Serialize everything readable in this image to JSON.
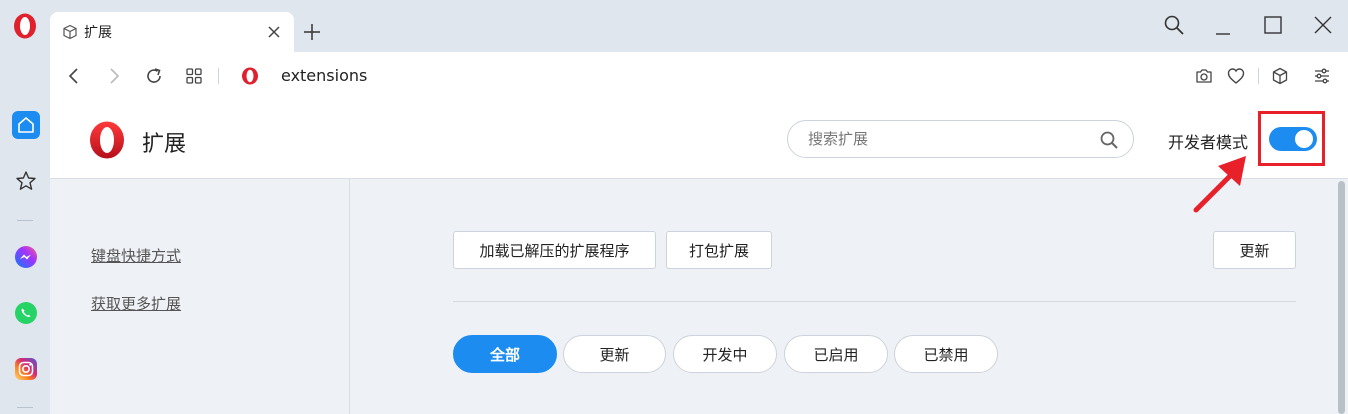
{
  "browser": {
    "tab": {
      "title": "扩展"
    },
    "address_bar": {
      "url": "extensions"
    }
  },
  "page": {
    "title": "扩展",
    "search": {
      "placeholder": "搜索扩展",
      "value": ""
    },
    "developer_mode": {
      "label": "开发者模式",
      "enabled": true
    },
    "sidebar_links": [
      "键盘快捷方式",
      "获取更多扩展"
    ],
    "actions": {
      "load_unpacked": "加载已解压的扩展程序",
      "pack": "打包扩展",
      "update": "更新"
    },
    "filters": [
      {
        "label": "全部",
        "active": true
      },
      {
        "label": "更新",
        "active": false
      },
      {
        "label": "开发中",
        "active": false
      },
      {
        "label": "已启用",
        "active": false
      },
      {
        "label": "已禁用",
        "active": false
      }
    ]
  },
  "colors": {
    "accent": "#1d8cf0",
    "highlight": "#e8202a",
    "opera_red": "#e0202d"
  },
  "icons": [
    "opera-logo-icon",
    "cube-icon",
    "close-icon",
    "plus-icon",
    "search-icon",
    "minimize-icon",
    "maximize-icon",
    "window-close-icon",
    "home-icon",
    "star-icon",
    "messenger-icon",
    "whatsapp-icon",
    "instagram-icon",
    "back-icon",
    "forward-icon",
    "reload-icon",
    "grid-icon",
    "camera-icon",
    "heart-icon",
    "box-icon",
    "settings-sliders-icon"
  ]
}
